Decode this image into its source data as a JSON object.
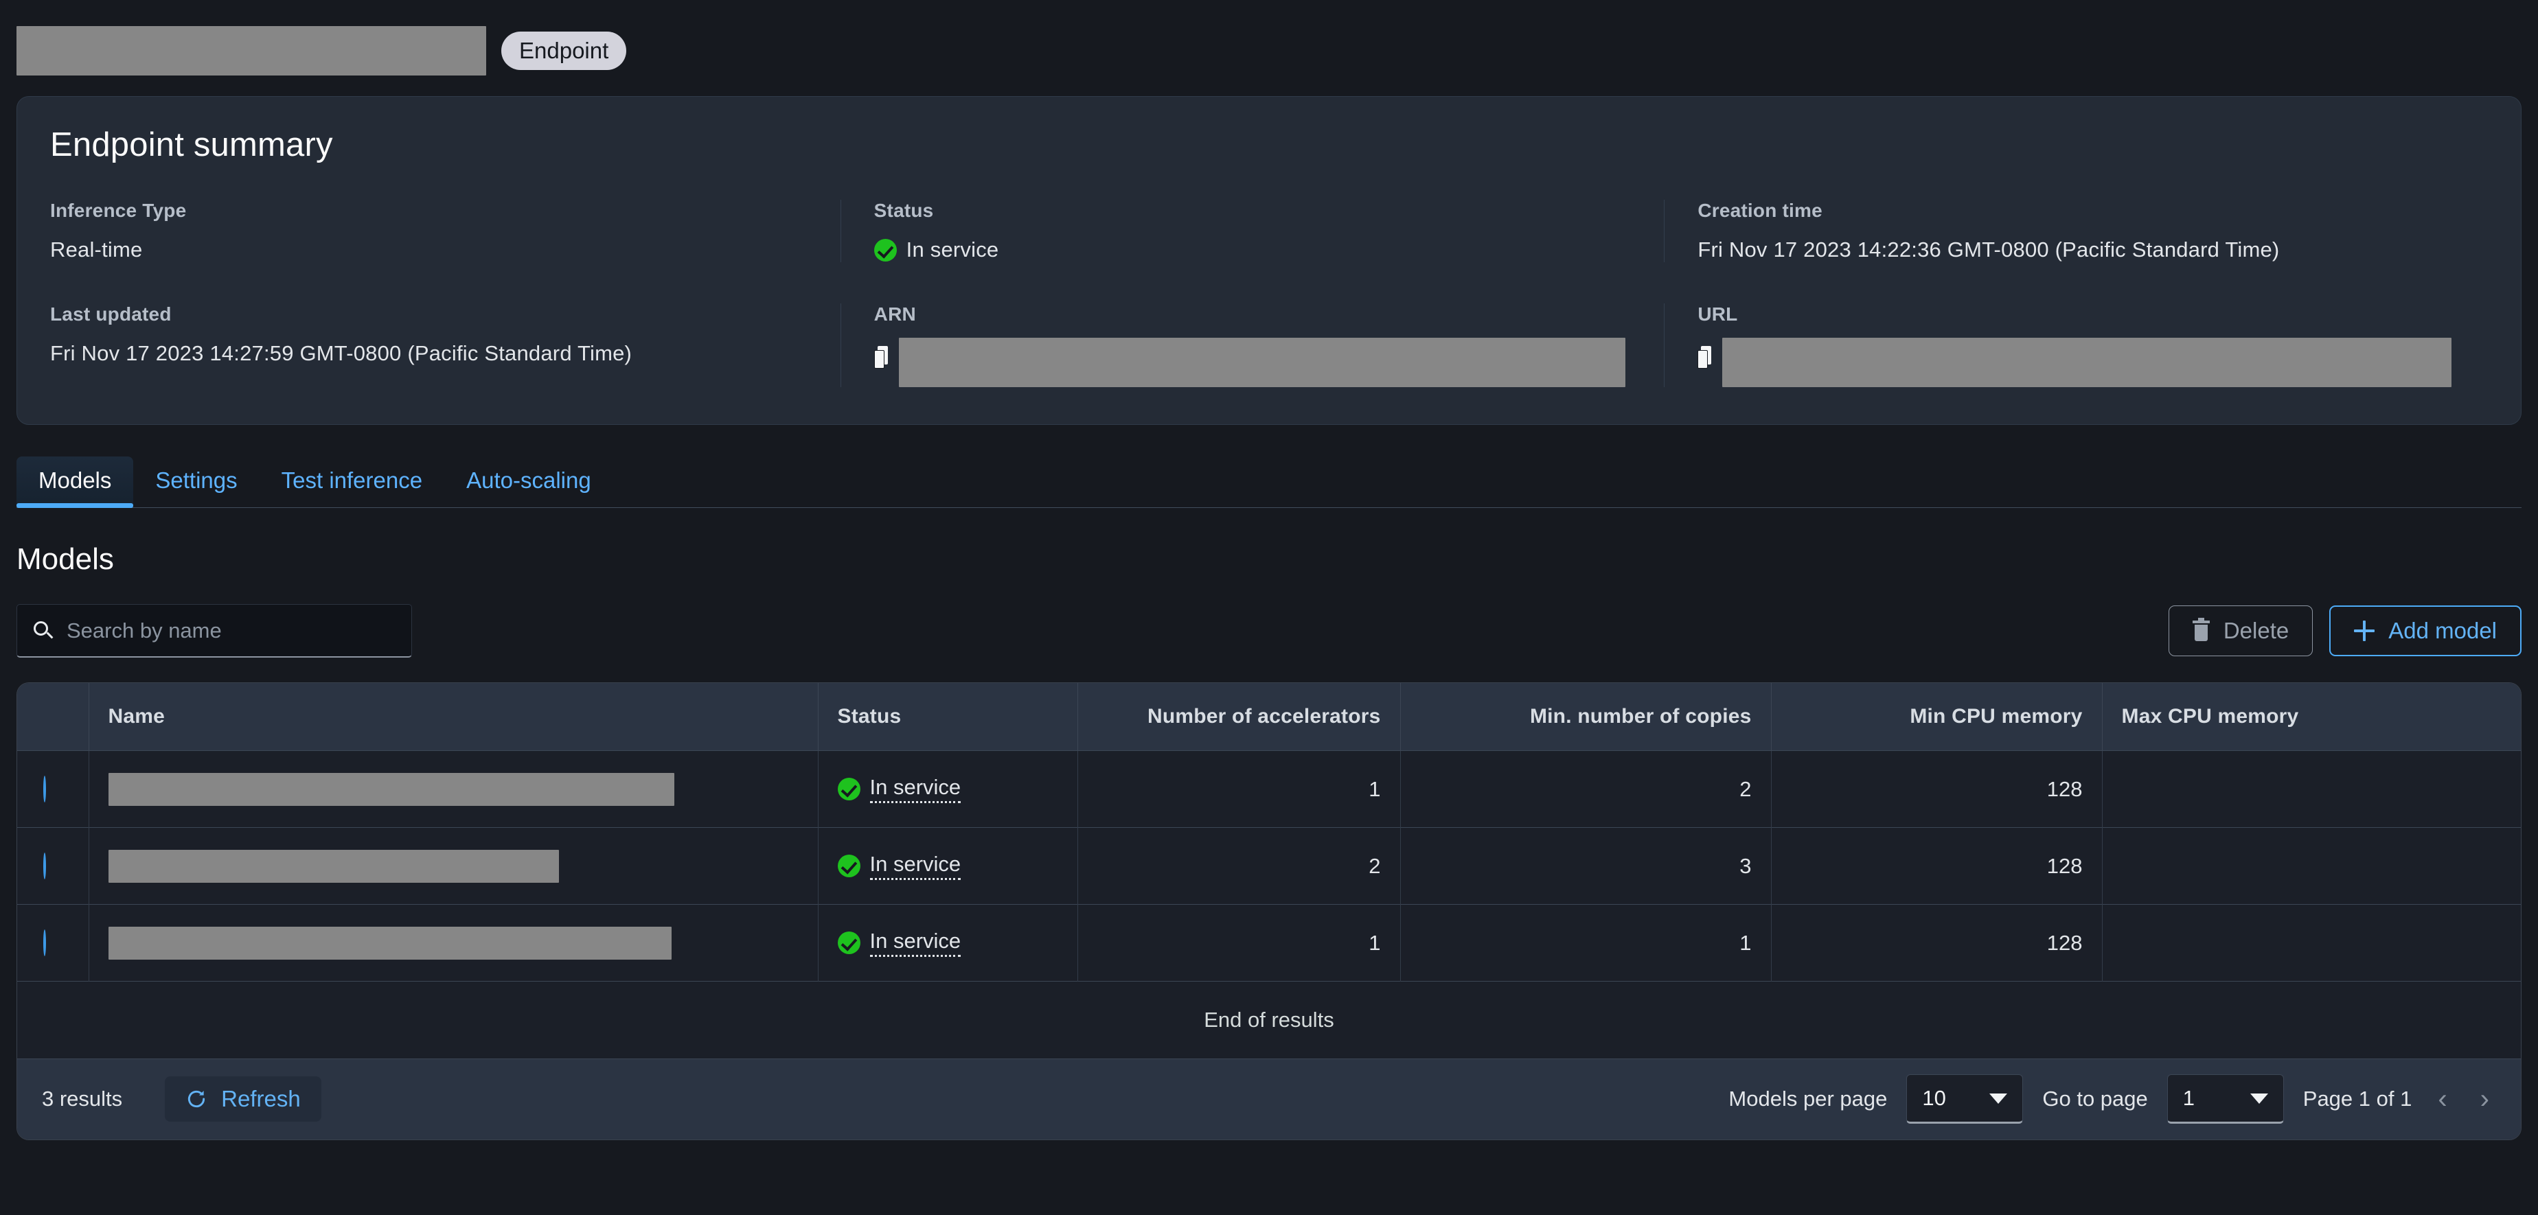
{
  "header": {
    "title_redacted": true,
    "badge_label": "Endpoint"
  },
  "summary": {
    "heading": "Endpoint summary",
    "fields": {
      "inference_type_label": "Inference Type",
      "inference_type_value": "Real-time",
      "status_label": "Status",
      "status_value": "In service",
      "creation_time_label": "Creation time",
      "creation_time_value": "Fri Nov 17 2023 14:22:36 GMT-0800 (Pacific Standard Time)",
      "last_updated_label": "Last updated",
      "last_updated_value": "Fri Nov 17 2023 14:27:59 GMT-0800 (Pacific Standard Time)",
      "arn_label": "ARN",
      "arn_value_redacted": true,
      "url_label": "URL",
      "url_value_redacted": true
    }
  },
  "tabs": [
    {
      "label": "Models",
      "active": true
    },
    {
      "label": "Settings",
      "active": false
    },
    {
      "label": "Test inference",
      "active": false
    },
    {
      "label": "Auto-scaling",
      "active": false
    }
  ],
  "models_section": {
    "heading": "Models",
    "search_placeholder": "Search by name",
    "search_value": "",
    "delete_label": "Delete",
    "add_model_label": "Add model"
  },
  "table": {
    "columns": [
      "Name",
      "Status",
      "Number of accelerators",
      "Min. number of copies",
      "Min CPU memory",
      "Max CPU memory"
    ],
    "rows": [
      {
        "name_redacted": true,
        "name_width": 824,
        "status": "In service",
        "accelerators": "1",
        "min_copies": "2",
        "min_cpu_memory": "128",
        "max_cpu_memory": ""
      },
      {
        "name_redacted": true,
        "name_width": 656,
        "status": "In service",
        "accelerators": "2",
        "min_copies": "3",
        "min_cpu_memory": "128",
        "max_cpu_memory": ""
      },
      {
        "name_redacted": true,
        "name_width": 820,
        "status": "In service",
        "accelerators": "1",
        "min_copies": "1",
        "min_cpu_memory": "128",
        "max_cpu_memory": ""
      }
    ],
    "end_of_results": "End of results"
  },
  "pagination": {
    "results_count": "3 results",
    "refresh_label": "Refresh",
    "per_page_label": "Models per page",
    "per_page_value": "10",
    "go_to_page_label": "Go to page",
    "go_to_page_value": "1",
    "page_indicator": "Page 1 of 1"
  },
  "colors": {
    "accent": "#4dabf7",
    "link": "#63b3f5",
    "success": "#1ec21e",
    "background": "#16191f",
    "panel": "#242b36",
    "table_header": "#2b3443"
  }
}
